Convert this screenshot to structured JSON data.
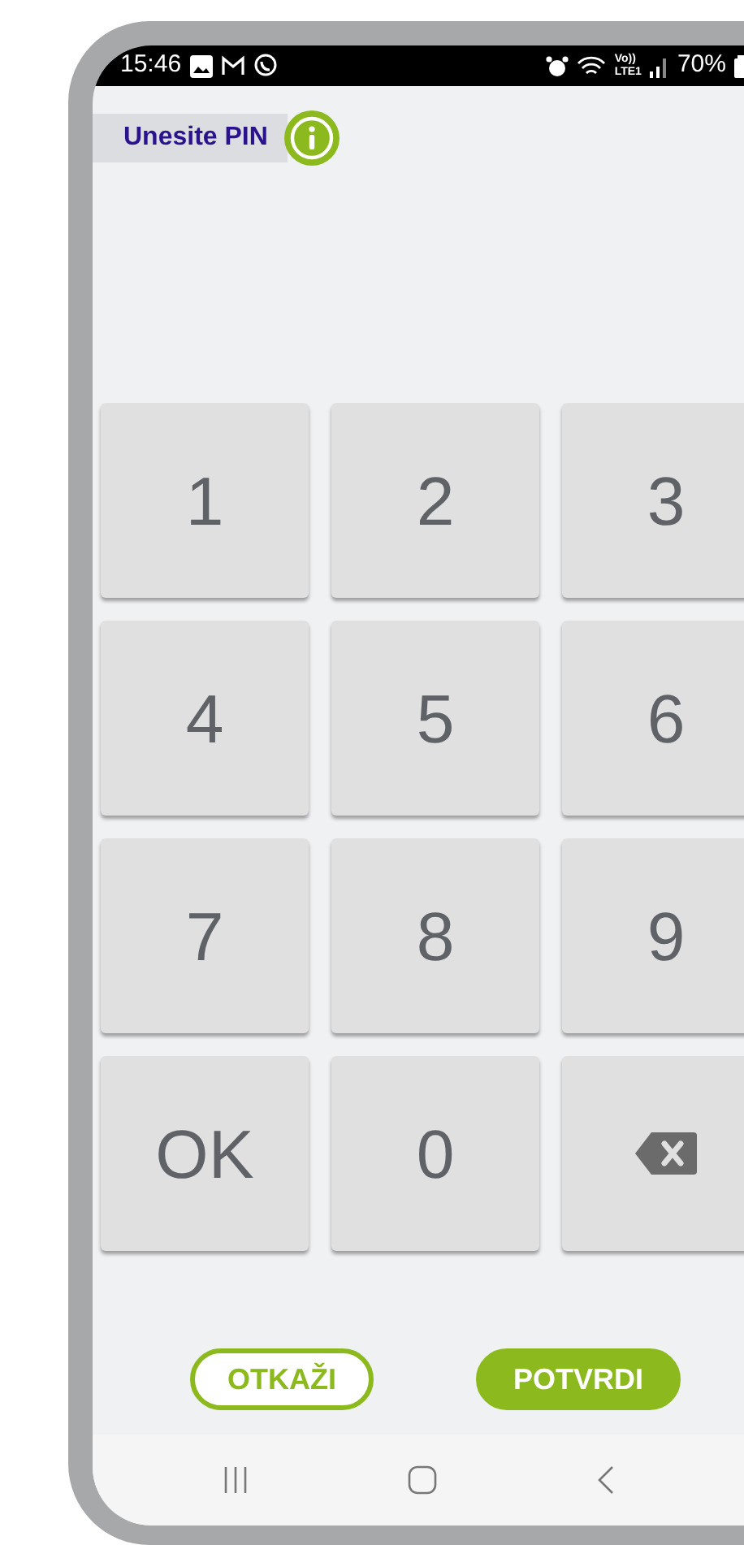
{
  "status_bar": {
    "time": "15:46",
    "network": [
      "Vo))",
      "LTE1"
    ],
    "battery": "70%"
  },
  "header": {
    "title": "Unesite PIN"
  },
  "keypad": [
    {
      "kind": "digit",
      "label": "1"
    },
    {
      "kind": "digit",
      "label": "2"
    },
    {
      "kind": "digit",
      "label": "3"
    },
    {
      "kind": "digit",
      "label": "4"
    },
    {
      "kind": "digit",
      "label": "5"
    },
    {
      "kind": "digit",
      "label": "6"
    },
    {
      "kind": "digit",
      "label": "7"
    },
    {
      "kind": "digit",
      "label": "8"
    },
    {
      "kind": "digit",
      "label": "9"
    },
    {
      "kind": "digit",
      "label": "OK"
    },
    {
      "kind": "digit",
      "label": "0"
    },
    {
      "kind": "backspace"
    }
  ],
  "buttons": [
    {
      "kind": "outline",
      "label": "OTKAŽI"
    },
    {
      "kind": "filled",
      "label": "POTVRDI"
    }
  ]
}
